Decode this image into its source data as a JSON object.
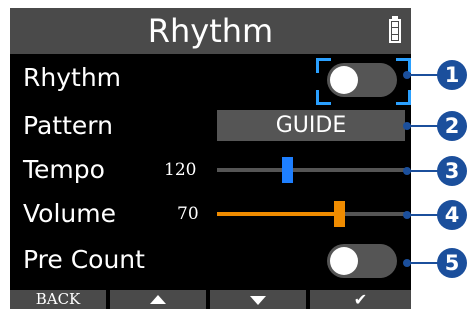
{
  "header": {
    "title": "Rhythm",
    "battery_icon": "battery-full-icon"
  },
  "rows": {
    "rhythm": {
      "label": "Rhythm",
      "toggle_on": false
    },
    "pattern": {
      "label": "Pattern",
      "value": "GUIDE"
    },
    "tempo": {
      "label": "Tempo",
      "value": "120",
      "level": 0.37,
      "color": "#1e7fff"
    },
    "volume": {
      "label": "Volume",
      "value": "70",
      "level": 0.66,
      "color": "#f08c00"
    },
    "precount": {
      "label": "Pre Count",
      "toggle_on": false
    }
  },
  "bottom": {
    "back_label": "BACK",
    "up_icon": "triangle-up-icon",
    "down_icon": "triangle-down-icon",
    "confirm_label": "✔"
  },
  "callouts": [
    "1",
    "2",
    "3",
    "4",
    "5"
  ],
  "colors": {
    "focus": "#2aa0ff",
    "callout": "#1b4f9c",
    "panel": "#4a4a4a"
  }
}
